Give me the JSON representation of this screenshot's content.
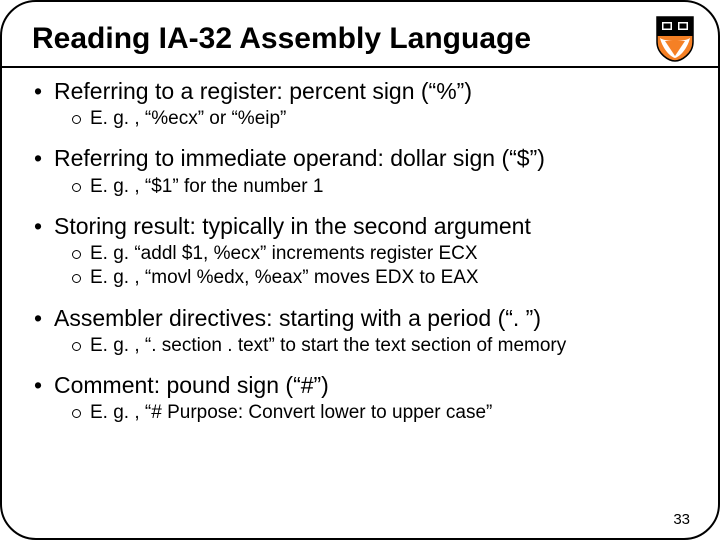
{
  "title": "Reading IA-32 Assembly Language",
  "bullets": [
    {
      "text": "Referring to a register: percent sign (“%”)",
      "sub": [
        "E. g. , “%ecx” or “%eip”"
      ]
    },
    {
      "text": "Referring to immediate operand: dollar sign (“$”)",
      "sub": [
        "E. g. , “$1” for the number 1"
      ]
    },
    {
      "text": "Storing result: typically in the second argument",
      "sub": [
        "E. g. “addl $1, %ecx” increments register ECX",
        "E. g. , “movl %edx, %eax” moves EDX to EAX"
      ]
    },
    {
      "text": "Assembler directives: starting with a period (“. ”)",
      "sub": [
        "E. g. , “. section . text” to start the text section of memory"
      ]
    },
    {
      "text": "Comment: pound sign (“#”)",
      "sub": [
        "E. g. , “# Purpose: Convert lower to upper case”"
      ]
    }
  ],
  "page_number": "33",
  "crest_alt": "princeton-shield-icon"
}
